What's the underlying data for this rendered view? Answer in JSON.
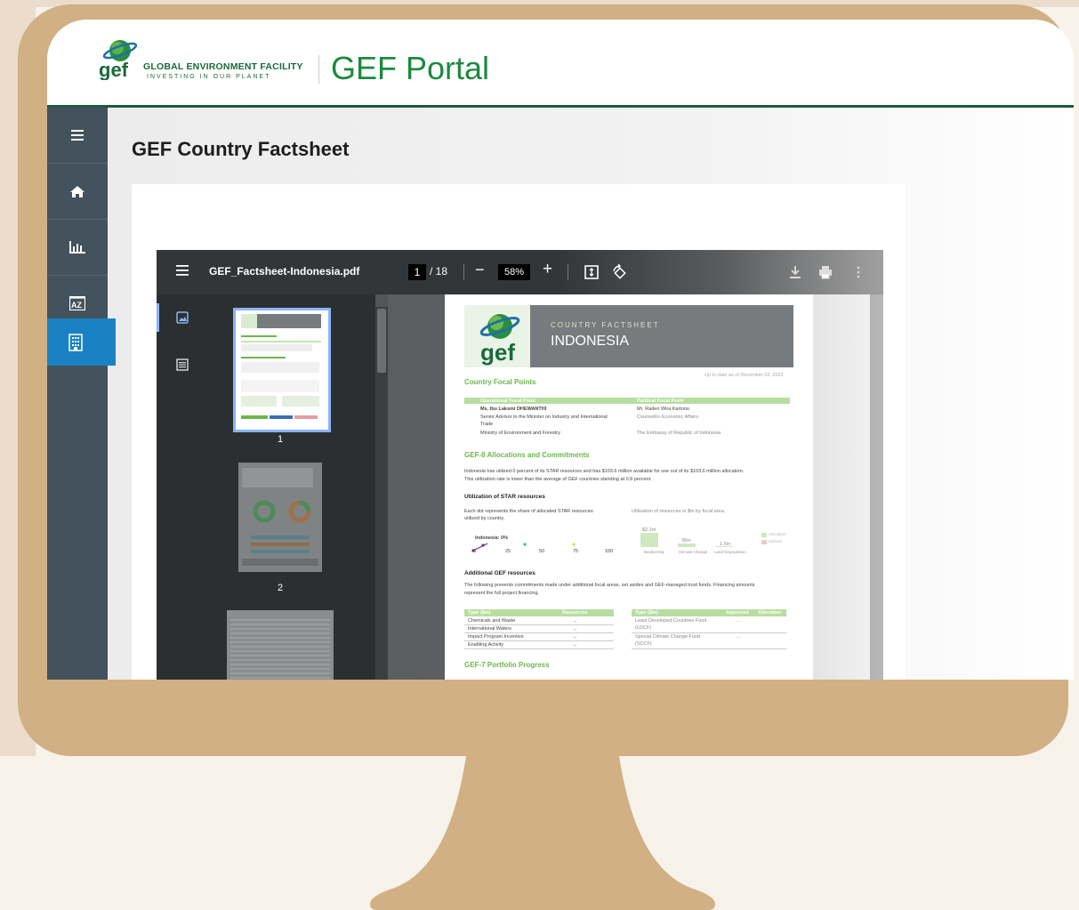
{
  "header": {
    "org_name": "GLOBAL ENVIRONMENT FACILITY",
    "tagline": "INVESTING IN OUR PLANET",
    "logo_text": "gef",
    "portal_title": "GEF Portal"
  },
  "sidebar": {
    "items": [
      {
        "icon": "menu-icon"
      },
      {
        "icon": "home-icon"
      },
      {
        "icon": "bar-chart-icon"
      },
      {
        "icon": "az-icon"
      },
      {
        "icon": "building-icon",
        "active": true
      }
    ]
  },
  "main": {
    "page_title": "GEF Country Factsheet"
  },
  "pdf_viewer": {
    "filename": "GEF_Factsheet-Indonesia.pdf",
    "current_page": "1",
    "total_pages": "/ 18",
    "zoom": "58%",
    "thumbnails": [
      {
        "label": "1"
      },
      {
        "label": "2"
      }
    ]
  },
  "pdf_page": {
    "logo_text": "gef",
    "banner_small": "COUNTRY FACTSHEET",
    "banner_title": "INDONESIA",
    "date": "Up to date as of December 02, 2022",
    "focal_heading": "Country Focal Points",
    "operational_header": "Operational Focal Point",
    "political_header": "Political Focal Point",
    "op_name": "Ms. Ibu Laksmi DHEWANTHI",
    "op_title_1": "Senior Advisor to the Minister on Industry and International",
    "op_title_2": "Trade",
    "op_org": "Ministry of Environment and Forestry",
    "pol_name": "Mr. Raden Wira Kartono",
    "pol_title": "Counsellor-Economic Affairs",
    "pol_org": "The Embassy of Republic of Indonesia",
    "alloc_heading": "GEF-8 Allocations and Commitments",
    "alloc_text_1": "Indonesia has utilized 0 percent of its STAR resources and has $103.6 million available for use out of its $103.6 million allocation.",
    "alloc_text_2": "This utilization rate is lower than the average of GEF countries standing at 0.8 percent.",
    "star_heading": "Utilization of STAR resources",
    "star_left_1": "Each dot represents the share of allocated STAR resources",
    "star_left_2": "utilized by country.",
    "star_right": "Utilization of resources in $m by focal area.",
    "indonesia_label": "Indonesia: 0%",
    "axis_ticks": [
      "0",
      "25",
      "50",
      "75",
      "100"
    ],
    "bar_labels": [
      "$2.2m",
      "35m",
      "1.5m"
    ],
    "bar_categories": [
      "Biodiversity",
      "Climate Change",
      "Land Degradation"
    ],
    "legend": [
      "Allocation",
      "Utilized"
    ],
    "additional_heading": "Additional GEF resources",
    "additional_text_1": "The following presents commitments made under additional focal areas, set asides and GEF-managed trust funds. Financing amounts",
    "additional_text_2": "represent the full project financing.",
    "table_left_headers": [
      "Type ($m)",
      "Resources"
    ],
    "table_left_rows": [
      [
        "Chemicals and Waste",
        "..."
      ],
      [
        "International Waters",
        "..."
      ],
      [
        "Impact Program Incentive",
        "..."
      ],
      [
        "Enabling Activity",
        "..."
      ]
    ],
    "table_right_headers": [
      "Type ($m)",
      "Approved",
      "Allocation"
    ],
    "table_right_rows": [
      [
        "Least Developed Countries Fund",
        "(LDCF)",
        "..."
      ],
      [
        "Special Climate Change Fund",
        "(SCCF)",
        "..."
      ]
    ],
    "portfolio_heading": "GEF-7 Portfolio Progress"
  },
  "colors": {
    "gef_green": "#1b8a3c",
    "header_rule": "#1e5b3b",
    "sidebar": "#44525d",
    "sidebar_active": "#1a82c4",
    "monitor_frame": "#d0b084",
    "pdf_green": "#6bb74a"
  }
}
